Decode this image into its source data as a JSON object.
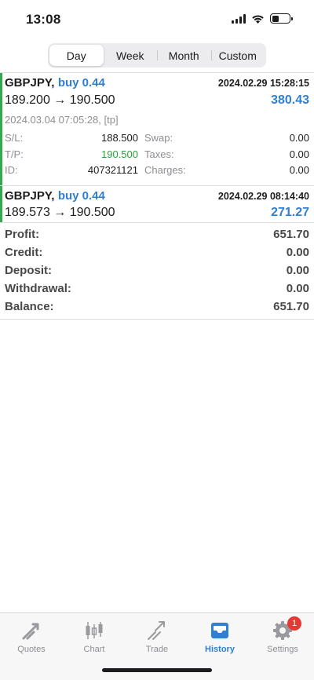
{
  "status_bar": {
    "time": "13:08"
  },
  "period_tabs": [
    {
      "label": "Day",
      "active": true
    },
    {
      "label": "Week",
      "active": false
    },
    {
      "label": "Month",
      "active": false
    },
    {
      "label": "Custom",
      "active": false
    }
  ],
  "trades": [
    {
      "symbol": "GBPJPY,",
      "side": "buy 0.44",
      "open_time": "2024.02.29 15:28:15",
      "prices": "189.200 → 190.500",
      "profit": "380.43",
      "close_info": "2024.03.04 07:05:28, [tp]",
      "details": {
        "sl_label": "S/L:",
        "sl_value": "188.500",
        "tp_label": "T/P:",
        "tp_value": "190.500",
        "id_label": "ID:",
        "id_value": "407321121",
        "swap_label": "Swap:",
        "swap_value": "0.00",
        "taxes_label": "Taxes:",
        "taxes_value": "0.00",
        "charges_label": "Charges:",
        "charges_value": "0.00"
      }
    },
    {
      "symbol": "GBPJPY,",
      "side": "buy 0.44",
      "open_time": "2024.02.29 08:14:40",
      "prices": "189.573 → 190.500",
      "profit": "271.27"
    }
  ],
  "summary": [
    {
      "label": "Profit:",
      "value": "651.70"
    },
    {
      "label": "Credit:",
      "value": "0.00"
    },
    {
      "label": "Deposit:",
      "value": "0.00"
    },
    {
      "label": "Withdrawal:",
      "value": "0.00"
    },
    {
      "label": "Balance:",
      "value": "651.70"
    }
  ],
  "tab_bar": [
    {
      "label": "Quotes",
      "icon": "quotes-icon",
      "active": false
    },
    {
      "label": "Chart",
      "icon": "chart-icon",
      "active": false
    },
    {
      "label": "Trade",
      "icon": "trade-icon",
      "active": false
    },
    {
      "label": "History",
      "icon": "history-icon",
      "active": true
    },
    {
      "label": "Settings",
      "icon": "settings-icon",
      "active": false,
      "badge": "1"
    }
  ],
  "colors": {
    "accent_blue": "#2f7fd3",
    "accent_green": "#36a94f",
    "tp_green": "#2aa23a",
    "badge_red": "#e53935"
  }
}
